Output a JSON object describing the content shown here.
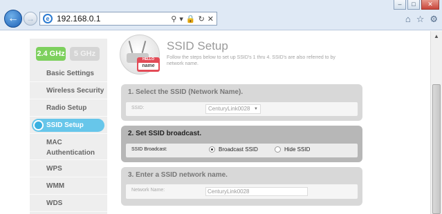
{
  "browser": {
    "address": "192.168.0.1",
    "window_controls": {
      "minimize": "–",
      "maximize": "□",
      "close": "✕"
    }
  },
  "sidebar": {
    "bands": [
      {
        "label": "2.4 GHz",
        "active": true
      },
      {
        "label": "5 GHz",
        "active": false
      }
    ],
    "items": [
      {
        "label": "Basic Settings"
      },
      {
        "label": "Wireless Security"
      },
      {
        "label": "Radio Setup"
      },
      {
        "label": "SSID Setup",
        "active": true
      },
      {
        "label": "MAC Authentication"
      },
      {
        "label": "WPS"
      },
      {
        "label": "WMM"
      },
      {
        "label": "WDS"
      }
    ]
  },
  "main": {
    "title": "SSID Setup",
    "subtitle": "Follow the steps below to set up SSID's 1 thru 4. SSID's are also referred to by network name.",
    "icon_text": {
      "hello": "HELLO",
      "name": "name"
    },
    "sections": [
      {
        "heading": "1. Select the SSID (Network Name).",
        "field_label": "SSID:",
        "select_value": "CenturyLink0028"
      },
      {
        "heading": "2. Set SSID broadcast.",
        "field_label": "SSID Broadcast:",
        "options": [
          {
            "label": "Broadcast SSID",
            "selected": true
          },
          {
            "label": "Hide SSID",
            "selected": false
          }
        ]
      },
      {
        "heading": "3. Enter a SSID network name.",
        "field_label": "Network Name:",
        "input_value": "CenturyLink0028"
      }
    ]
  }
}
